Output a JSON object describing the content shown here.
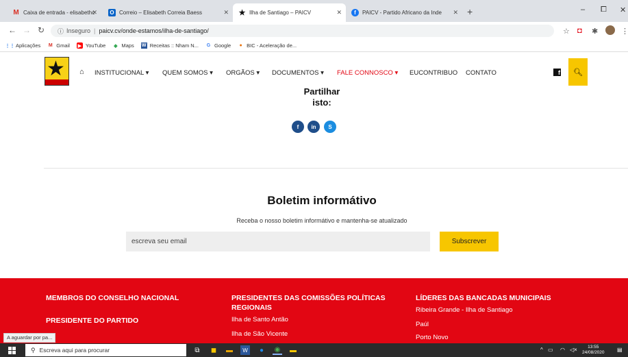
{
  "browser": {
    "tabs": [
      {
        "title": "Caixa de entrada - elisabethc.mc",
        "icon": "gmail-icon",
        "active": false
      },
      {
        "title": "Correio – Elisabeth Correia Baess",
        "icon": "outlook-icon",
        "active": false
      },
      {
        "title": "Ilha de Santiago – PAICV",
        "icon": "star-icon",
        "active": true
      },
      {
        "title": "PAICV - Partido Africano da Inde",
        "icon": "facebook-icon",
        "active": false
      }
    ],
    "new_tab": "+",
    "window_controls": {
      "minimize": "–",
      "maximize": "⧠",
      "close": "✕"
    },
    "security_label": "Inseguro",
    "url": "paicv.cv/onde-estamos/ilha-de-santiago/",
    "bookmarks": [
      {
        "label": "Aplicações",
        "icon": "apps-icon"
      },
      {
        "label": "Gmail",
        "icon": "gmail-icon"
      },
      {
        "label": "YouTube",
        "icon": "youtube-icon"
      },
      {
        "label": "Maps",
        "icon": "maps-icon"
      },
      {
        "label": "Receitas :: Nham N...",
        "icon": "word-icon"
      },
      {
        "label": "Google",
        "icon": "google-icon"
      },
      {
        "label": "BIC - Aceleração de...",
        "icon": "bic-icon"
      }
    ],
    "status_tip": "A aguardar por pa..."
  },
  "site": {
    "nav": [
      {
        "label": "INSTITUCIONAL ▾",
        "highlight": false
      },
      {
        "label": "QUEM SOMOS ▾",
        "highlight": false
      },
      {
        "label": "ORGÃOS ▾",
        "highlight": false
      },
      {
        "label": "DOCUMENTOS ▾",
        "highlight": false
      },
      {
        "label": "FALE CONNOSCO ▾",
        "highlight": true
      },
      {
        "label": "EUCONTRIBUO",
        "highlight": false
      },
      {
        "label": "CONTATO",
        "highlight": false
      }
    ],
    "share_label_1": "Partilhar",
    "share_label_2": "isto:",
    "newsletter": {
      "title": "Boletim informátivo",
      "subtitle": "Receba o nosso boletim informátivo e mantenha-se atualizado",
      "placeholder": "escreva seu email",
      "button": "Subscrever"
    },
    "footer": {
      "col1": {
        "heading1": "MEMBROS DO CONSELHO NACIONAL",
        "heading2": "PRESIDENTE DO PARTIDO"
      },
      "col2": {
        "heading": "PRESIDENTES DAS COMISSÕES POLÍTICAS REGIONAIS",
        "links": [
          "Ilha de Santo Antão",
          "Ilha de São Vicente"
        ]
      },
      "col3": {
        "heading": "LÍDERES DAS BANCADAS MUNICIPAIS",
        "links": [
          "Ribeira Grande - Ilha de Santiago",
          "Paúl",
          "Porto Novo"
        ]
      }
    }
  },
  "taskbar": {
    "search_placeholder": "Escreva aqui para procurar",
    "time": "13:55",
    "date": "24/08/2020"
  },
  "colors": {
    "brand_red": "#e20613",
    "brand_yellow": "#f7c600"
  }
}
